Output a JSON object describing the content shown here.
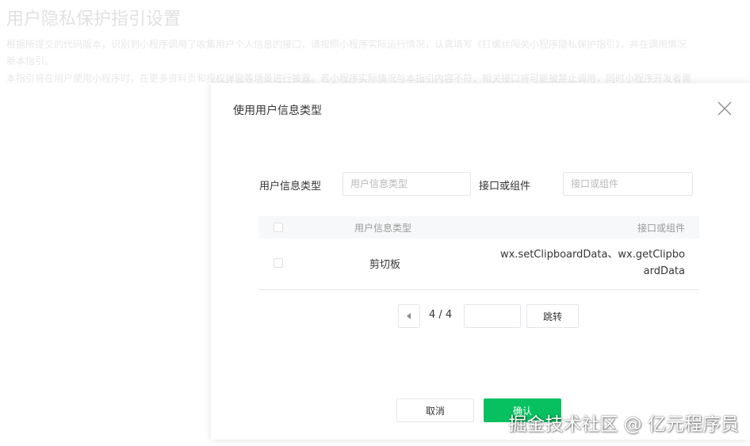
{
  "background": {
    "page_title": "用户隐私保护指引设置",
    "line1": "根据所提交的代码版本，识别到小程序调用了收集用户个人信息的接口，请按照小程序实际运行情况，认真填写《打螺丝闯关小程序隐私保护指引》，并在调用情况",
    "line2": "新本指引。",
    "line3": "本指引将在用户使用小程序时，在更多资料页和授权弹窗等场景进行披露。若小程序实际情况与本指引内容不符，相关接口将可能被禁止调用，同时小程序开发者需"
  },
  "dialog": {
    "title": "使用用户信息类型",
    "filters": {
      "type_label": "用户信息类型",
      "type_placeholder": "用户信息类型",
      "api_label": "接口或组件",
      "api_placeholder": "接口或组件"
    },
    "table": {
      "columns": [
        "用户信息类型",
        "接口或组件"
      ],
      "rows": [
        {
          "type": "剪切板",
          "api": "wx.setClipboardData、wx.getClipboardData"
        }
      ]
    },
    "pagination": {
      "current": "4 / 4",
      "jump_label": "跳转"
    },
    "buttons": {
      "cancel": "取消",
      "confirm": "确认"
    }
  },
  "watermark": "掘金技术社区 @ 亿元程序员",
  "colors": {
    "accent": "#07c160",
    "header_bg": "#f6f8f9",
    "border": "#e4e6eb"
  },
  "icons": {
    "close": "close-icon",
    "prev_page": "chevron-left-icon"
  }
}
